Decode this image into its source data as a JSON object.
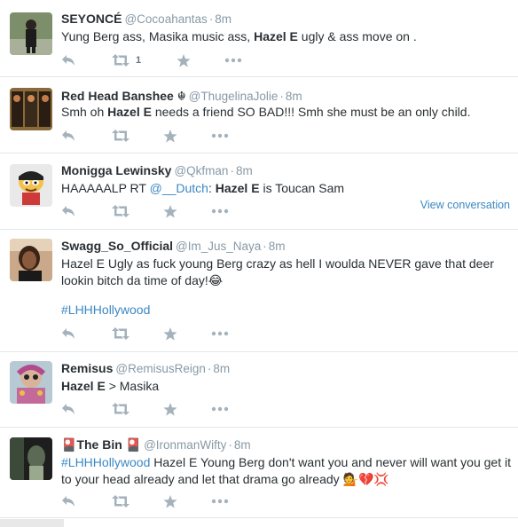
{
  "tweets": [
    {
      "fullname": "SEYONCÉ",
      "username": "@Cocoahantas",
      "time": "8m",
      "text": [
        {
          "t": "Yung Berg ass, Masika music ass, "
        },
        {
          "t": "Hazel E",
          "b": true
        },
        {
          "t": " ugly & ass move on ."
        }
      ],
      "retweet_count": "1"
    },
    {
      "fullname": "Red Head Banshee ☬",
      "username": "@ThugelinaJolie",
      "time": "8m",
      "text": [
        {
          "t": "Smh oh "
        },
        {
          "t": "Hazel E",
          "b": true
        },
        {
          "t": " needs a friend SO BAD!!! Smh she must be an only child."
        }
      ]
    },
    {
      "fullname": "Monigga Lewinsky",
      "username": "@Qkfman",
      "time": "8m",
      "text": [
        {
          "t": "HAAAAALP RT "
        },
        {
          "t": "@__Dutch",
          "link": true
        },
        {
          "t": ": "
        },
        {
          "t": "Hazel E",
          "b": true
        },
        {
          "t": " is Toucan Sam"
        }
      ],
      "view_conversation": "View conversation"
    },
    {
      "fullname": "Swagg_So_Official",
      "username": "@Im_Jus_Naya",
      "time": "8m",
      "text": [
        {
          "t": "Hazel E Ugly as fuck young Berg crazy as hell I woulda NEVER gave that deer lookin bitch da time of day!😂"
        }
      ],
      "hashtag_line": "#LHHHollywood"
    },
    {
      "fullname": "Remisus",
      "username": "@RemisusReign",
      "time": "8m",
      "text": [
        {
          "t": "Hazel E",
          "b": true
        },
        {
          "t": " > Masika"
        }
      ]
    },
    {
      "fullname": "🎴The Bin 🎴",
      "username": "@IronmanWifty",
      "time": "8m",
      "text": [
        {
          "t": "#LHHHollywood",
          "link": true
        },
        {
          "t": " Hazel E Young Berg don't want you and never will want you get it to your head already and let that drama go already 💁💔💢"
        }
      ]
    }
  ],
  "icons": {
    "reply": "reply-icon",
    "retweet": "retweet-icon",
    "favorite": "star-icon",
    "more": "more-icon"
  },
  "colors": {
    "icon": "#a4b2bc",
    "link": "#3b88c3",
    "meta": "#8899a6"
  }
}
